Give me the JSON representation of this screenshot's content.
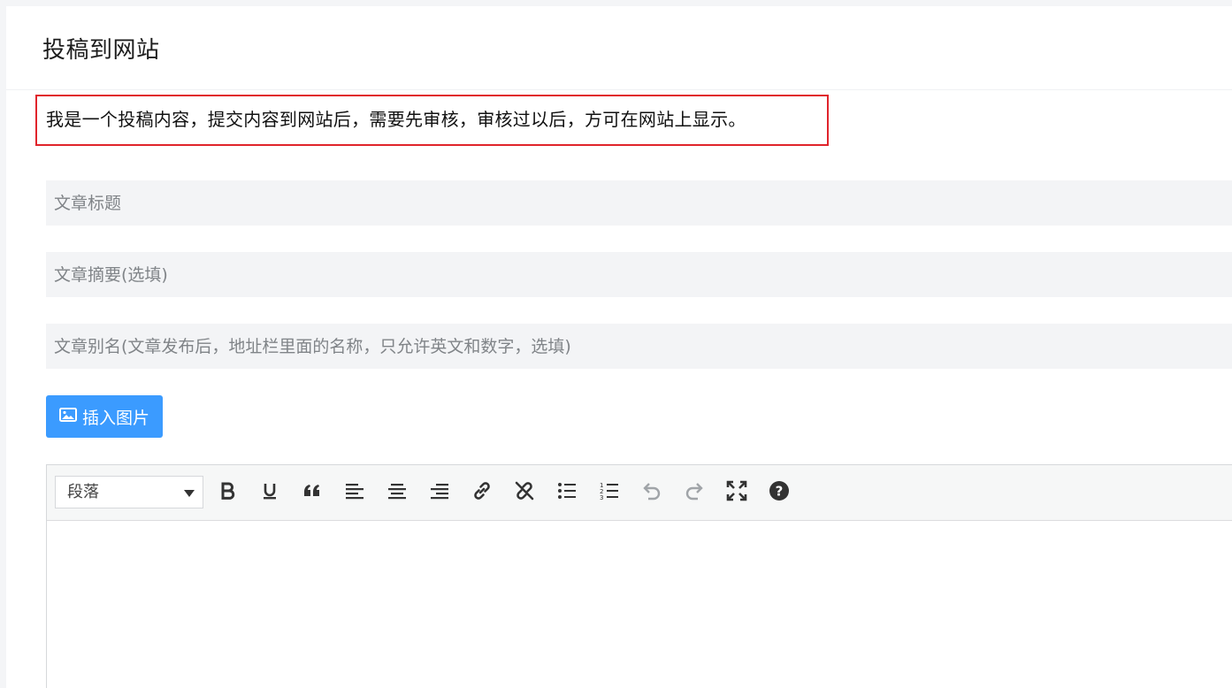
{
  "header": {
    "title": "投稿到网站"
  },
  "notice": {
    "text": "我是一个投稿内容，提交内容到网站后，需要先审核，审核过以后，方可在网站上显示。"
  },
  "form": {
    "title_placeholder": "文章标题",
    "excerpt_placeholder": "文章摘要(选填)",
    "slug_placeholder": "文章别名(文章发布后，地址栏里面的名称，只允许英文和数字，选填)",
    "insert_image_label": "插入图片"
  },
  "editor": {
    "format_selected": "段落",
    "toolbar_icons": [
      "bold-icon",
      "underline-icon",
      "blockquote-icon",
      "align-left-icon",
      "align-center-icon",
      "align-right-icon",
      "link-icon",
      "unlink-icon",
      "bullet-list-icon",
      "numbered-list-icon",
      "undo-icon",
      "redo-icon",
      "fullscreen-icon",
      "help-icon"
    ]
  },
  "colors": {
    "accent": "#3b9bff",
    "notice_border": "#e0242b",
    "input_bg": "#f3f4f6"
  }
}
